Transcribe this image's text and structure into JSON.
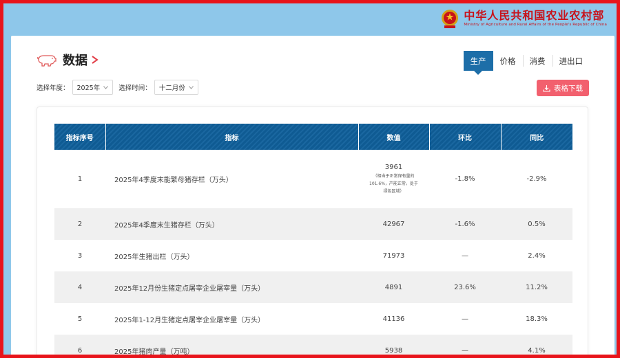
{
  "brand": {
    "name_cn": "中华人民共和国农业农村部",
    "name_en": "Ministry of Agriculture and Rural Affairs of the People's Republic of China"
  },
  "page": {
    "title": "数据"
  },
  "tabs": [
    {
      "label": "生产",
      "active": true
    },
    {
      "label": "价格",
      "active": false
    },
    {
      "label": "消费",
      "active": false
    },
    {
      "label": "进出口",
      "active": false
    }
  ],
  "filters": {
    "year_label": "选择年度：",
    "year_value": "2025年",
    "time_label": "选择时间：",
    "time_value": "十二月份"
  },
  "download": {
    "label": "表格下载"
  },
  "table": {
    "headers": [
      "指标序号",
      "指标",
      "数值",
      "环比",
      "同比"
    ],
    "rows": [
      {
        "index": "1",
        "name": "2025年4季度末能繁母猪存栏（万头）",
        "value": "3961",
        "note": "（相当于正常保有量的101.6%，产能正常，处于绿色区域）",
        "mom": "-1.8%",
        "yoy": "-2.9%"
      },
      {
        "index": "2",
        "name": "2025年4季度末生猪存栏（万头）",
        "value": "42967",
        "note": "",
        "mom": "-1.6%",
        "yoy": "0.5%"
      },
      {
        "index": "3",
        "name": "2025年生猪出栏（万头）",
        "value": "71973",
        "note": "",
        "mom": "—",
        "yoy": "2.4%"
      },
      {
        "index": "4",
        "name": "2025年12月份生猪定点屠宰企业屠宰量（万头）",
        "value": "4891",
        "note": "",
        "mom": "23.6%",
        "yoy": "11.2%"
      },
      {
        "index": "5",
        "name": "2025年1-12月生猪定点屠宰企业屠宰量（万头）",
        "value": "41136",
        "note": "",
        "mom": "—",
        "yoy": "18.3%"
      },
      {
        "index": "6",
        "name": "2025年猪肉产量（万吨）",
        "value": "5938",
        "note": "",
        "mom": "—",
        "yoy": "4.1%"
      }
    ]
  },
  "colors": {
    "accent": "#1d6ea8",
    "header": "#0f5b93",
    "download": "#f2606e",
    "brand": "#c8121a",
    "border": "#e8141b"
  }
}
